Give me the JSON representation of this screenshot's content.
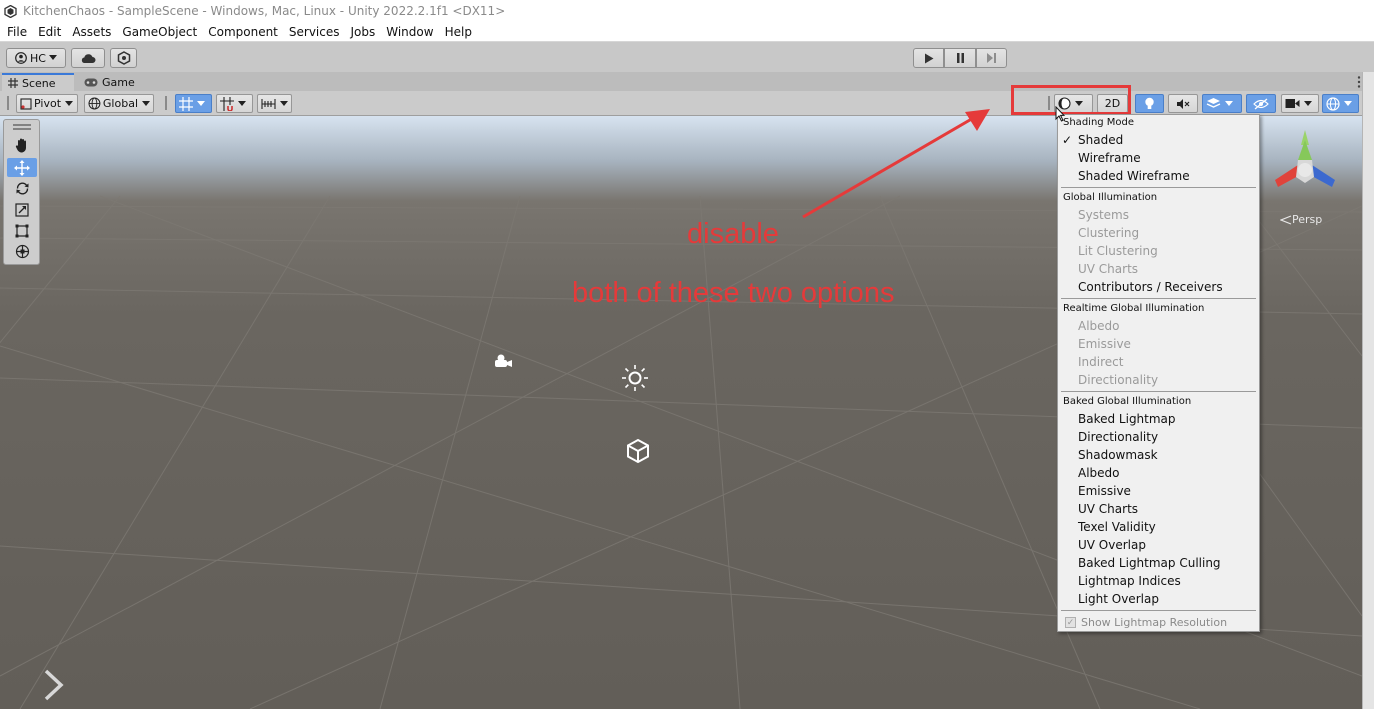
{
  "window": {
    "title": "KitchenChaos - SampleScene - Windows, Mac, Linux - Unity 2022.2.1f1 <DX11>"
  },
  "menubar": {
    "items": [
      "File",
      "Edit",
      "Assets",
      "GameObject",
      "Component",
      "Services",
      "Jobs",
      "Window",
      "Help"
    ]
  },
  "toolbar": {
    "account_label": "HC"
  },
  "tabs": [
    {
      "label": "Scene",
      "icon": "hash-icon",
      "active": true
    },
    {
      "label": "Game",
      "icon": "gamepad-icon",
      "active": false
    }
  ],
  "scene_toolbar": {
    "pivot_label": "Pivot",
    "global_label": "Global",
    "two_d_label": "2D"
  },
  "viewport": {
    "projection_label": "Persp"
  },
  "annotations": {
    "line1": "disable",
    "line2": "both of these two options",
    "color": "#e53a3a"
  },
  "dropdown": {
    "shading_mode": {
      "header": "Shading Mode",
      "items": [
        {
          "label": "Shaded",
          "checked": true
        },
        {
          "label": "Wireframe",
          "checked": false
        },
        {
          "label": "Shaded Wireframe",
          "checked": false
        }
      ]
    },
    "global_illumination": {
      "header": "Global Illumination",
      "items": [
        "Systems",
        "Clustering",
        "Lit Clustering",
        "UV Charts",
        "Contributors / Receivers"
      ]
    },
    "realtime_gi": {
      "header": "Realtime Global Illumination",
      "items": [
        "Albedo",
        "Emissive",
        "Indirect",
        "Directionality"
      ]
    },
    "baked_gi": {
      "header": "Baked Global Illumination",
      "items": [
        "Baked Lightmap",
        "Directionality",
        "Shadowmask",
        "Albedo",
        "Emissive",
        "UV Charts",
        "Texel Validity",
        "UV Overlap",
        "Baked Lightmap Culling",
        "Lightmap Indices",
        "Light Overlap"
      ]
    },
    "footer": {
      "label": "Show Lightmap Resolution",
      "checked": true
    }
  },
  "colors": {
    "accent": "#3a79d8",
    "selected_tool": "#6a9fe6"
  }
}
